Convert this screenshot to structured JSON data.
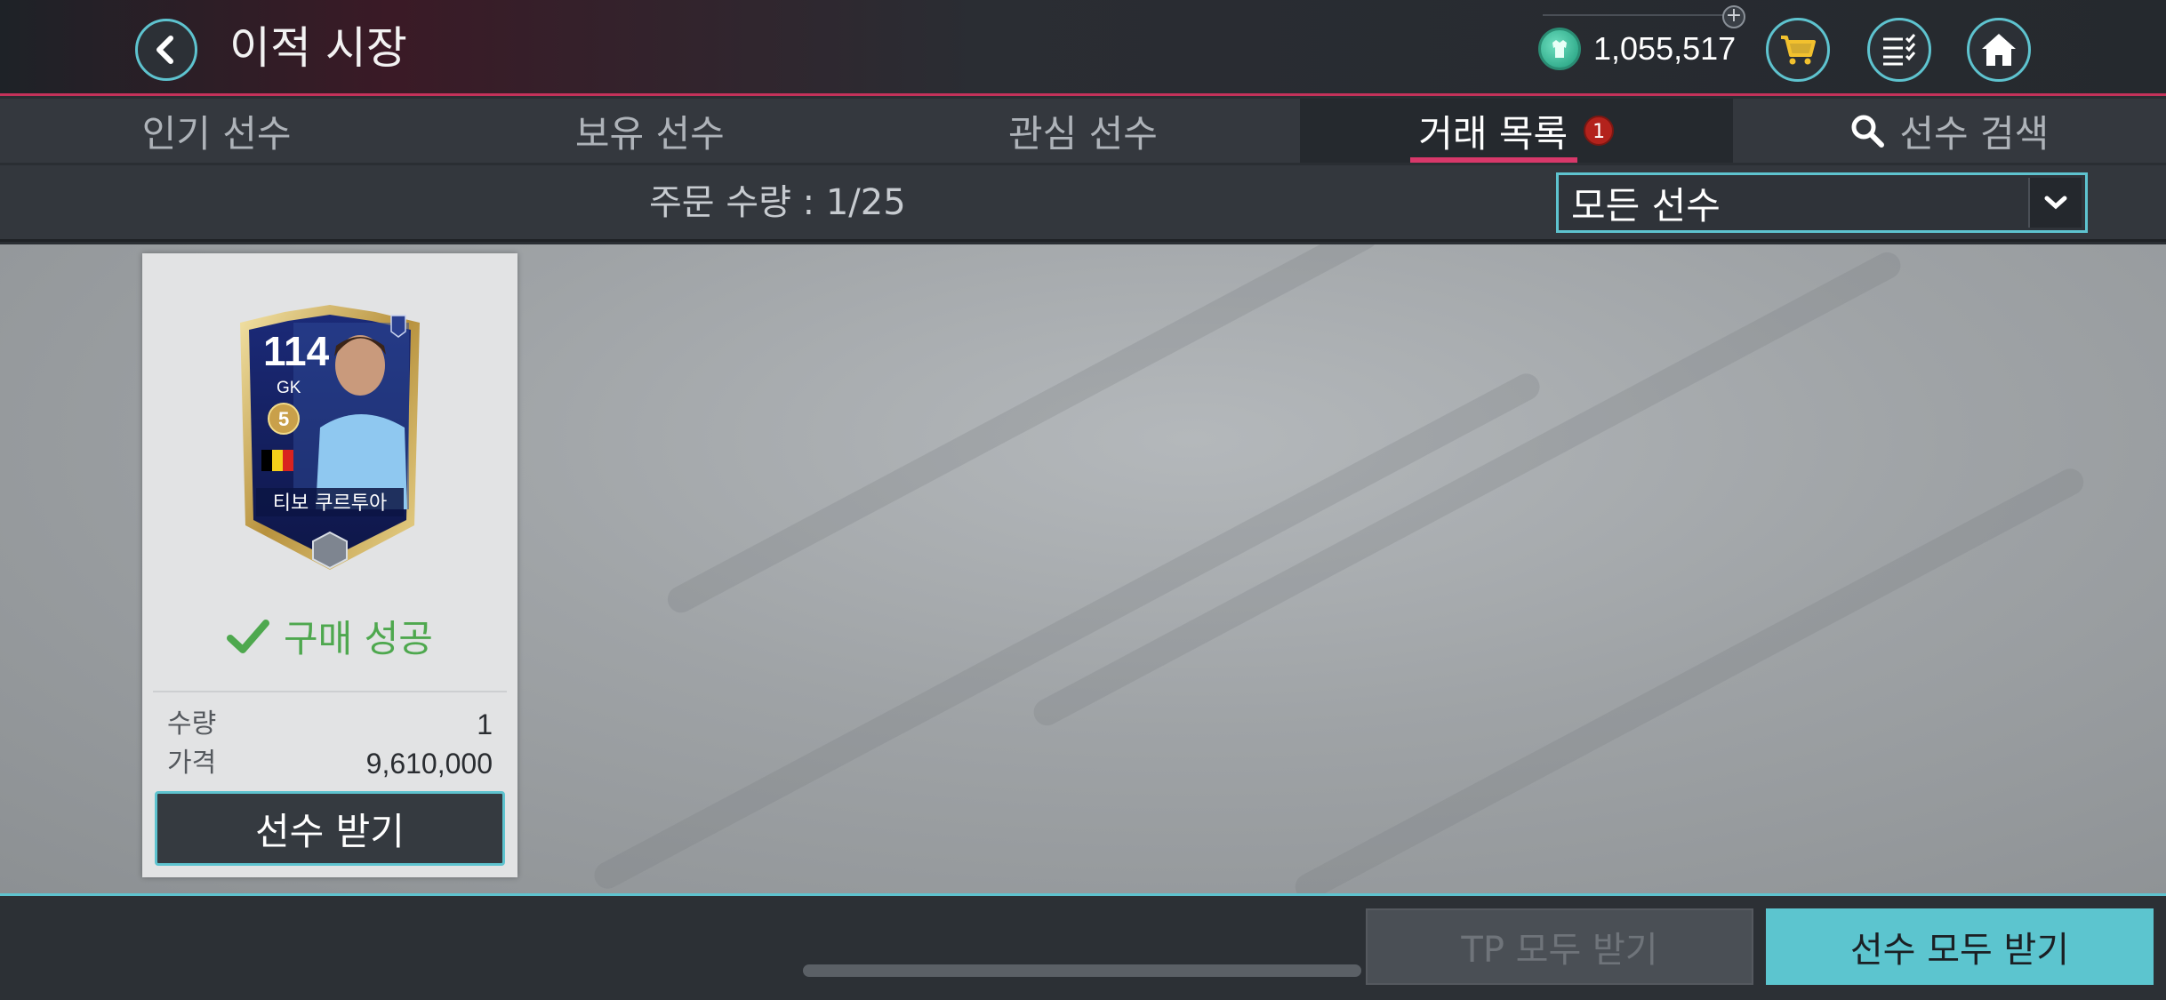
{
  "header": {
    "title": "이적 시장",
    "currency_value": "1,055,517",
    "currency_icon": "tp-coin-icon",
    "plus_label": "+"
  },
  "tabs": [
    {
      "label": "인기 선수",
      "active": false
    },
    {
      "label": "보유 선수",
      "active": false
    },
    {
      "label": "관심 선수",
      "active": false
    },
    {
      "label": "거래 목록",
      "active": true,
      "badge": "1"
    },
    {
      "label": "선수 검색",
      "active": false,
      "icon": "search-icon"
    }
  ],
  "filter": {
    "order_count": "주문 수량 : 1/25",
    "dropdown_value": "모든 선수"
  },
  "card": {
    "player": {
      "ovr": "114",
      "position": "GK",
      "level": "5",
      "name": "티보 쿠르투아",
      "nation_flag": "belgium-flag"
    },
    "status": "구매 성공",
    "quantity_label": "수량",
    "quantity_value": "1",
    "price_label": "가격",
    "price_value": "9,610,000",
    "receive_button": "선수 받기"
  },
  "bottom": {
    "tp_button": "TP 모두 받기",
    "all_button": "선수 모두 받기"
  },
  "colors": {
    "accent": "#5ec3cf",
    "tab_underline": "#d8386a",
    "success": "#4ea84e",
    "badge": "#b3221c"
  }
}
